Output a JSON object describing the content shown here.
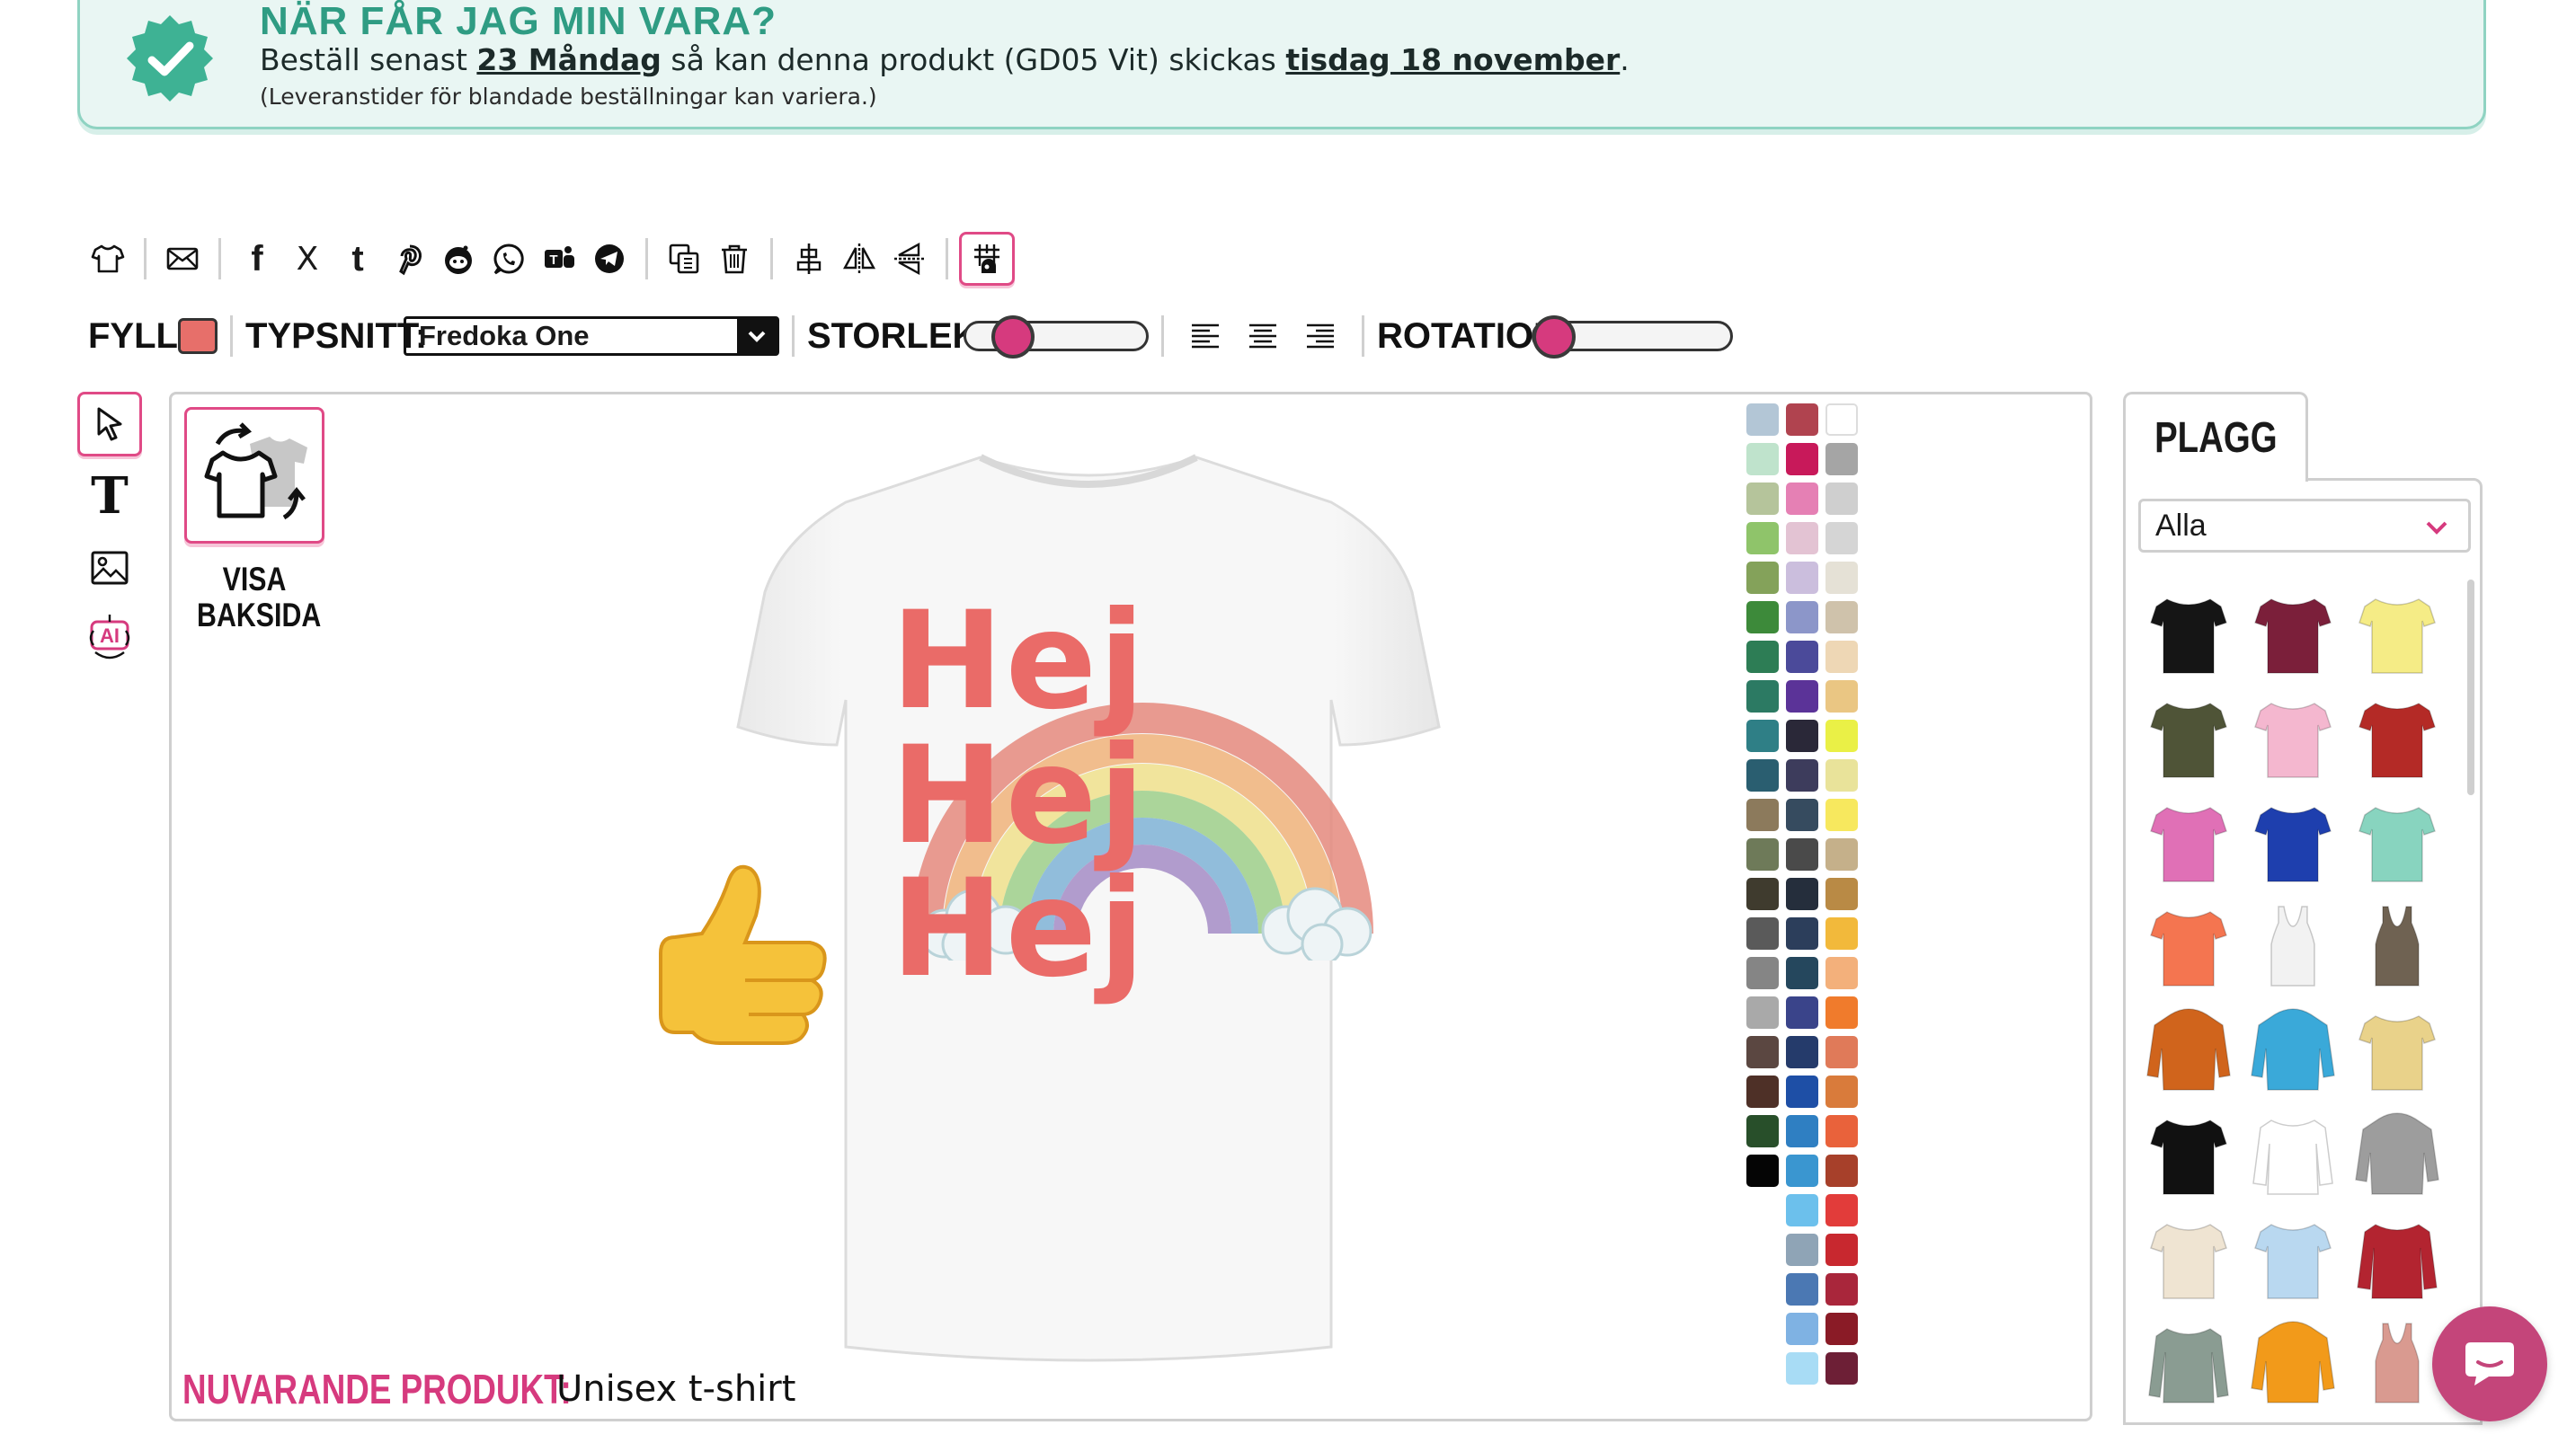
{
  "banner": {
    "title": "NÄR FÅR JAG MIN VARA?",
    "line_pre": "Beställ senast",
    "order_by": "23 Måndag",
    "line_mid": "så kan denna produkt (GD05 Vit) skickas",
    "ship_date": "tisdag 18 november",
    "line_end": ".",
    "note": "(Leveranstider för blandade beställningar kan variera.)"
  },
  "toolbar": {
    "icons": [
      "tshirt-icon",
      "mail-icon",
      "facebook-icon",
      "x-icon",
      "tumblr-icon",
      "pinterest-icon",
      "reddit-icon",
      "whatsapp-icon",
      "teams-icon",
      "telegram-icon",
      "duplicate-icon",
      "trash-icon",
      "align-center-icon",
      "flip-horizontal-icon",
      "flip-vertical-icon",
      "grid-icon"
    ],
    "x_glyph": "X",
    "tumblr_glyph": "t",
    "facebook_glyph": "f"
  },
  "props": {
    "fill_label": "FYLL:",
    "fill_color": "#e76f6a",
    "font_label": "TYPSNITT:",
    "font_value": "Fredoka One",
    "size_label": "STORLEK:",
    "size_level": 0.2,
    "rotation_label": "ROTATION:",
    "rotation_level": 0.0
  },
  "tools": {
    "items": [
      "select-tool",
      "text-tool",
      "image-tool",
      "ai-tool"
    ],
    "text_glyph": "T"
  },
  "canvas": {
    "backside_label_1": "VISA",
    "backside_label_2": "BAKSIDA",
    "design_text_1": "Hej",
    "design_text_2": "Hej",
    "design_text_3": "Hej",
    "design_text_color": "#ea6b68",
    "current_label": "NUVARANDE PRODUKT:",
    "current_value": "Unisex t-shirt"
  },
  "colors": [
    "#b3c6d6",
    "#b0434f",
    "#ffffff",
    "#bfe3cc",
    "#c8195a",
    "#a5a5a5",
    "#b5c49b",
    "#e580b4",
    "#cfcfcf",
    "#8fc46a",
    "#e3c3d3",
    "#d5d5d5",
    "#84a25a",
    "#cbbedd",
    "#e5e1d6",
    "#3d8a3a",
    "#8c96c9",
    "#cfc2ab",
    "#2d7d55",
    "#4b4a9a",
    "#eed7b5",
    "#2c7a63",
    "#5b3398",
    "#eac683",
    "#2f7f86",
    "#2a2838",
    "#eaf046",
    "#2a5e70",
    "#3d3c5c",
    "#e9e39a",
    "#8c7a5c",
    "#364b5f",
    "#f7e85e",
    "#6e7a59",
    "#4a4a4a",
    "#c5b08a",
    "#3f3b2e",
    "#252e3c",
    "#b98a45",
    "#5a5a5a",
    "#2c3e5b",
    "#f2b93b",
    "#858585",
    "#25475d",
    "#f3b07b",
    "#a9a9a9",
    "#3a448a",
    "#f07b2c",
    "#5b4741",
    "#253b6b",
    "#e07a59",
    "#4e3027",
    "#1e4fa6",
    "#d97b3b",
    "#284f2a",
    "#2f7fc2",
    "#e9623b",
    "#050505",
    "#3a96d0",
    "#a7402a",
    null,
    "#6cc0ec",
    "#e23c3a",
    null,
    "#8fa4b6",
    "#c8282f",
    null,
    "#4b78b3",
    "#a9263b",
    null,
    "#7fb2e3",
    "#8a1b26",
    null,
    "#a8dcf5",
    "#6d1f36"
  ],
  "panel": {
    "tab_label": "PLAGG",
    "filter_value": "Alla",
    "garments": [
      {
        "kind": "tee",
        "color": "#151515"
      },
      {
        "kind": "tee",
        "color": "#7b1f3a"
      },
      {
        "kind": "tee",
        "color": "#f5ec86"
      },
      {
        "kind": "tee",
        "color": "#4f5437"
      },
      {
        "kind": "tee",
        "color": "#f4b7cf"
      },
      {
        "kind": "tee",
        "color": "#b42a26"
      },
      {
        "kind": "tee",
        "color": "#e070b6"
      },
      {
        "kind": "tee",
        "color": "#1e3fae"
      },
      {
        "kind": "tee",
        "color": "#88d4bf"
      },
      {
        "kind": "tee",
        "color": "#f47550"
      },
      {
        "kind": "tank",
        "color": "#f2f2f2"
      },
      {
        "kind": "tank",
        "color": "#6f6252"
      },
      {
        "kind": "hoodie",
        "color": "#d0641c"
      },
      {
        "kind": "hoodie",
        "color": "#3aa9d9"
      },
      {
        "kind": "tee",
        "color": "#e9d28a"
      },
      {
        "kind": "tee",
        "color": "#111111"
      },
      {
        "kind": "raglan",
        "color": "#ffffff"
      },
      {
        "kind": "hoodie",
        "color": "#9d9d9d"
      },
      {
        "kind": "tee",
        "color": "#efe4d2"
      },
      {
        "kind": "tee",
        "color": "#b9d8f0"
      },
      {
        "kind": "jacket",
        "color": "#b32430"
      },
      {
        "kind": "longsleeve",
        "color": "#8a9c92"
      },
      {
        "kind": "hoodie",
        "color": "#f29a1a"
      },
      {
        "kind": "tank",
        "color": "#d99a90"
      }
    ]
  },
  "chat": {
    "icon": "chat-icon"
  }
}
